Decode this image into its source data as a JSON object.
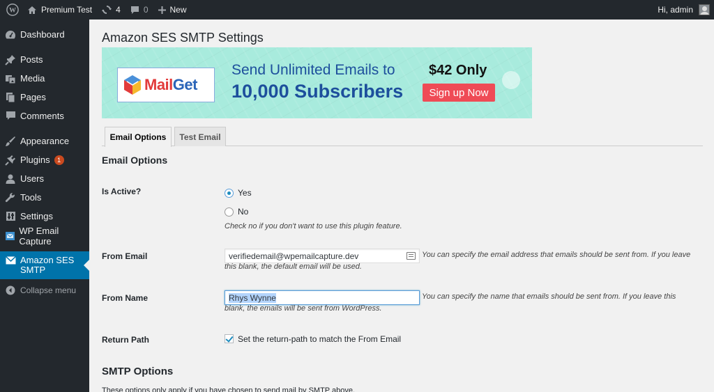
{
  "adminbar": {
    "site_name": "Premium Test",
    "updates_count": "4",
    "comments_count": "0",
    "new_label": "New",
    "greeting": "Hi, admin"
  },
  "sidebar": {
    "items": [
      {
        "label": "Dashboard",
        "icon": "dashboard-icon"
      },
      {
        "label": "Posts",
        "icon": "pin-icon"
      },
      {
        "label": "Media",
        "icon": "media-icon"
      },
      {
        "label": "Pages",
        "icon": "pages-icon"
      },
      {
        "label": "Comments",
        "icon": "comment-icon"
      },
      {
        "label": "Appearance",
        "icon": "brush-icon"
      },
      {
        "label": "Plugins",
        "icon": "plugin-icon",
        "badge": "1"
      },
      {
        "label": "Users",
        "icon": "users-icon"
      },
      {
        "label": "Tools",
        "icon": "wrench-icon"
      },
      {
        "label": "Settings",
        "icon": "settings-icon"
      },
      {
        "label": "WP Email Capture",
        "icon": "email-capture-icon"
      },
      {
        "label": "Amazon SES SMTP",
        "icon": "envelope-icon",
        "current": true
      },
      {
        "label": "Collapse menu",
        "icon": "collapse-icon"
      }
    ]
  },
  "page": {
    "title": "Amazon SES SMTP Settings"
  },
  "banner": {
    "brand_mail": "Mail",
    "brand_get": "Get",
    "line1": "Send Unlimited Emails to",
    "line2": "10,000 Subscribers",
    "price": "$42 Only",
    "cta": "Sign up Now"
  },
  "tabs": [
    {
      "label": "Email Options",
      "active": true
    },
    {
      "label": "Test Email",
      "active": false
    }
  ],
  "email_options": {
    "heading": "Email Options",
    "is_active": {
      "label": "Is Active?",
      "options": [
        "Yes",
        "No"
      ],
      "selected": "Yes",
      "description": "Check no if you don't want to use this plugin feature."
    },
    "from_email": {
      "label": "From Email",
      "value": "verifiedemail@wpemailcapture.dev",
      "description": "You can specify the email address that emails should be sent from. If you leave this blank, the default email will be used."
    },
    "from_name": {
      "label": "From Name",
      "value": "Rhys Wynne",
      "description": "You can specify the name that emails should be sent from. If you leave this blank, the emails will be sent from WordPress."
    },
    "return_path": {
      "label": "Return Path",
      "checkbox_label": "Set the return-path to match the From Email",
      "checked": true
    }
  },
  "smtp_options": {
    "heading": "SMTP Options",
    "note": "These options only apply if you have chosen to send mail by SMTP above."
  }
}
